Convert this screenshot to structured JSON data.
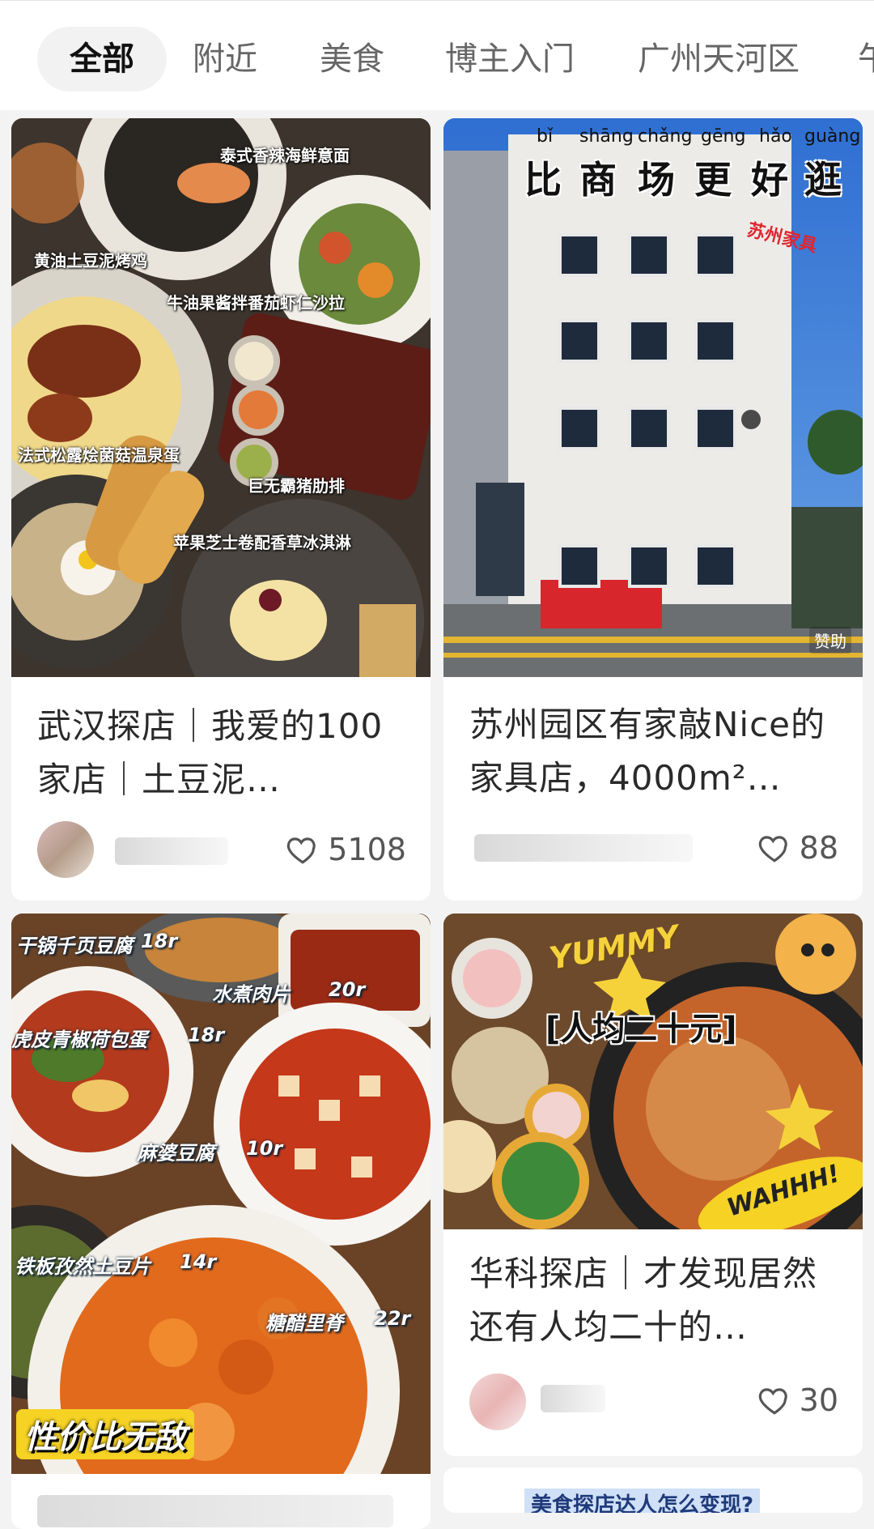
{
  "tabs": [
    {
      "label": "全部",
      "active": true
    },
    {
      "label": "附近",
      "active": false
    },
    {
      "label": "美食",
      "active": false
    },
    {
      "label": "博主入门",
      "active": false
    },
    {
      "label": "广州天河区",
      "active": false
    },
    {
      "label": "午",
      "active": false
    }
  ],
  "cards": [
    {
      "title": "武汉探店｜我爱的100家店｜土豆泥…",
      "likes": "5108",
      "image_labels": [
        "泰式香辣海鲜意面",
        "黄油土豆泥烤鸡",
        "牛油果酱拌番茄虾仁沙拉",
        "法式松露烩菌菇温泉蛋",
        "巨无霸猪肋排",
        "苹果芝士卷配香草冰淇淋"
      ]
    },
    {
      "title": "苏州园区有家敲Nice的家具店，4000m²…",
      "likes": "88",
      "badge": "赞助",
      "image_pinyin": [
        "bǐ",
        "shāng",
        "chǎng",
        "gēng",
        "hǎo",
        "guàng"
      ],
      "image_headline": [
        "比",
        "商",
        "场",
        "更",
        "好",
        "逛"
      ],
      "image_tag": "苏州家具"
    },
    {
      "title": "",
      "image_labels": [
        {
          "name": "干锅千页豆腐",
          "price": "18r"
        },
        {
          "name": "水煮肉片",
          "price": "20r"
        },
        {
          "name": "虎皮青椒荷包蛋",
          "price": "18r"
        },
        {
          "name": "麻婆豆腐",
          "price": "10r"
        },
        {
          "name": "铁板孜然土豆片",
          "price": "14r"
        },
        {
          "name": "糖醋里脊",
          "price": "22r"
        }
      ],
      "image_stamp": "性价比无敌"
    },
    {
      "title": "华科探店｜才发现居然还有人均二十的…",
      "likes": "30",
      "image_banner": "[人均二十元]",
      "image_sticker_top": "YUMMY",
      "image_sticker_bottom": "WAHHH!"
    },
    {
      "image_banner": "美食探店达人怎么变现?"
    }
  ],
  "colors": {
    "accent_red": "#e0252e",
    "sky_blue": "#3a7bd5"
  },
  "icons": [
    "heart-outline-icon"
  ]
}
